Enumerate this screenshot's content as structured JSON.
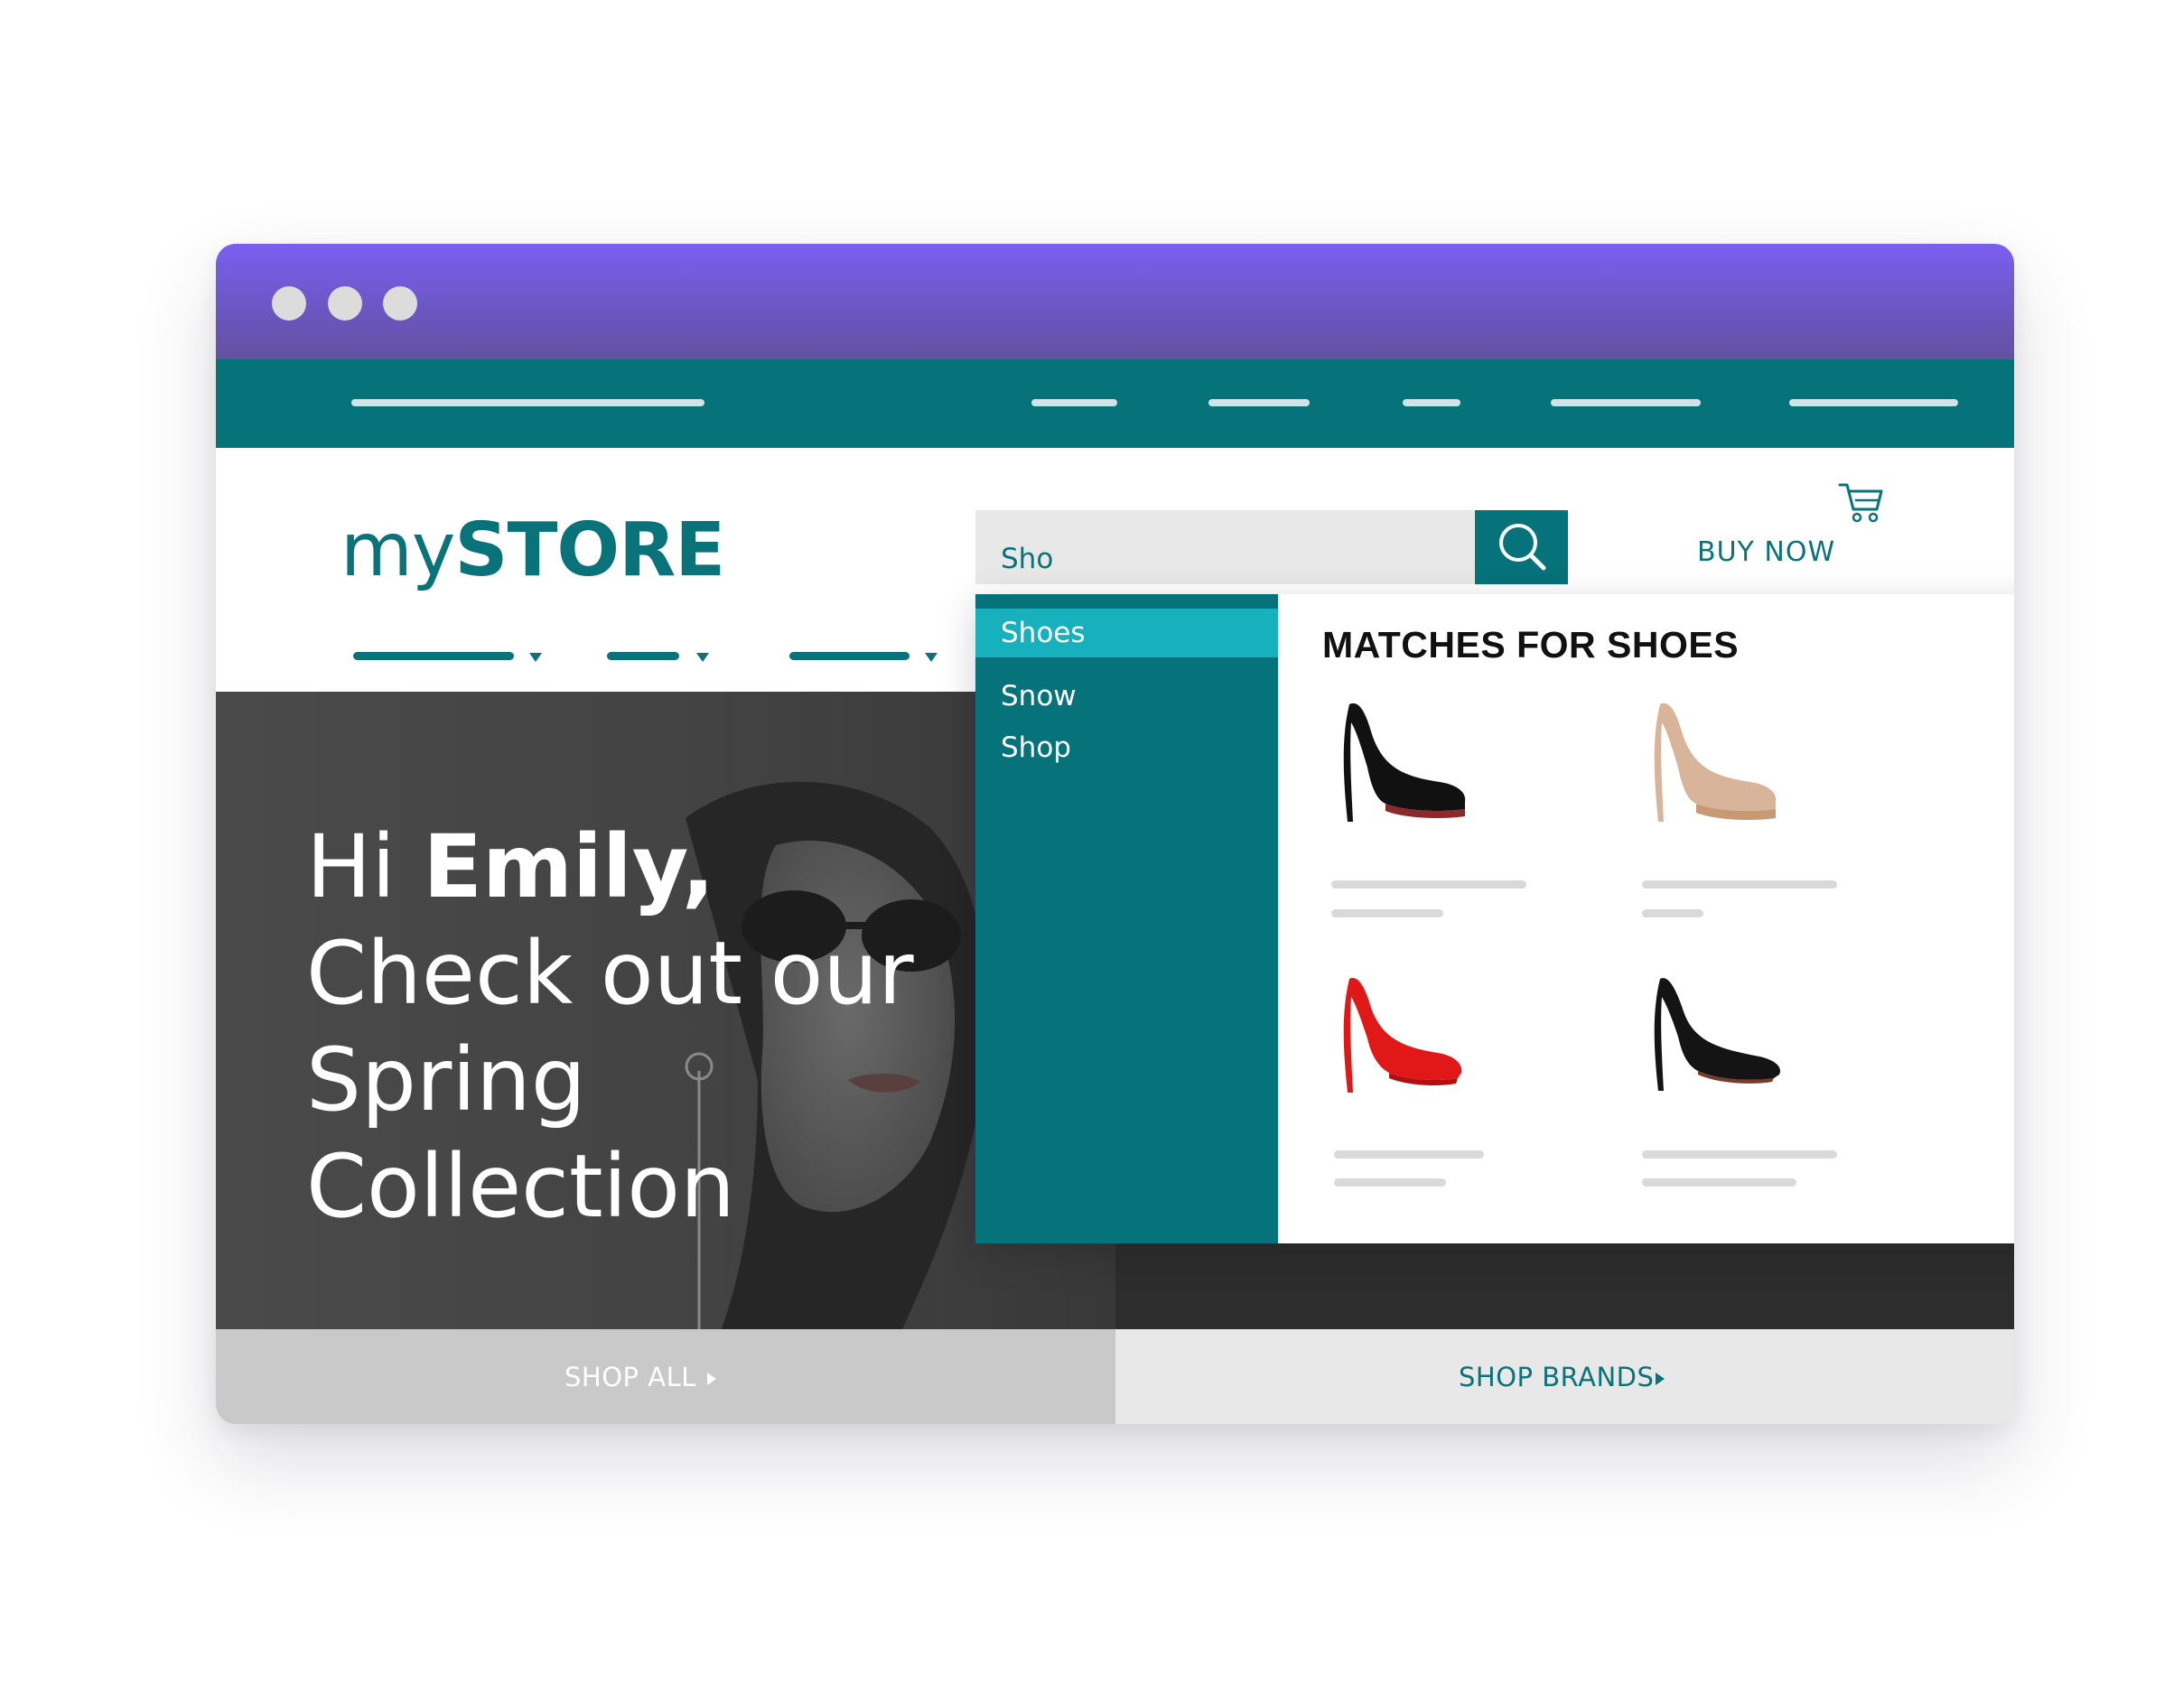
{
  "search": {
    "query": "Sho"
  },
  "store": {
    "logo_light": "my",
    "logo_bold": "STORE",
    "buy_now": "BUY NOW"
  },
  "hero": {
    "greeting": "Hi ",
    "name": "Emily,",
    "line2": "Check out our",
    "line3": "Spring",
    "line4": "Collection"
  },
  "suggestions": [
    {
      "label": "Shoes",
      "active": true
    },
    {
      "label": "Snow",
      "active": false
    },
    {
      "label": "Shop",
      "active": false
    }
  ],
  "matches": {
    "title": "MATCHES FOR SHOES",
    "products": [
      {
        "name": "black-platform-heel",
        "color": "#111111",
        "sole": "#8a2a2a"
      },
      {
        "name": "gold-platform-heel",
        "color": "#d8b49a",
        "sole": "#c79a74"
      },
      {
        "name": "red-peep-toe-heel",
        "color": "#e01818",
        "sole": "#b01010"
      },
      {
        "name": "black-pump-heel",
        "color": "#141414",
        "sole": "#7a3a2a"
      }
    ]
  },
  "footer": {
    "shop_all": "SHOP ALL",
    "shop_brands": "SHOP BRANDS"
  },
  "colors": {
    "teal": "#06727a",
    "teal_light": "#16b1bd",
    "purple": "#7b5ff0"
  },
  "icons": {
    "search": "search-icon",
    "cart": "cart-icon"
  }
}
